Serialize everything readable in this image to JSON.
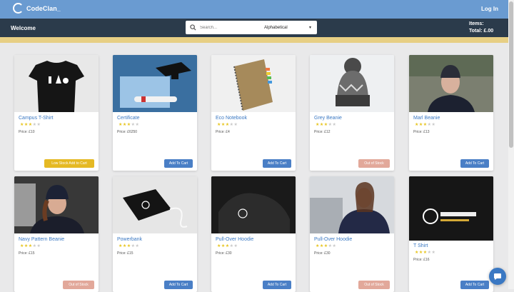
{
  "header": {
    "brand": "CodeClan_",
    "login_label": "Log In"
  },
  "nav": {
    "welcome": "Welcome",
    "search_placeholder": "Search...",
    "sort_selected": "Alphabetical",
    "items_label": "Items:",
    "total_label": "Total: £.00"
  },
  "colors": {
    "topbar": "#6a9bd1",
    "navbar": "#2b3b4b",
    "accent": "#e7cf84",
    "link": "#3a78c3",
    "add_button": "#4a7fc6",
    "low_stock_button": "#e5b924",
    "out_of_stock_button": "#e2a89a"
  },
  "products": [
    {
      "name": "Campus T-Shirt",
      "price": "Price: £10",
      "rating": 3,
      "button": "Low Stock Add to Cart",
      "status": "low"
    },
    {
      "name": "Certificate",
      "price": "Price: £6250",
      "rating": 3,
      "button": "Add To Cart",
      "status": "add"
    },
    {
      "name": "Eco Notebook",
      "price": "Price: £4",
      "rating": 3,
      "button": "Add To Cart",
      "status": "add"
    },
    {
      "name": "Grey Beanie",
      "price": "Price: £12",
      "rating": 3,
      "button": "Out of Stock",
      "status": "out"
    },
    {
      "name": "Marl Beanie",
      "price": "Price: £13",
      "rating": 3,
      "button": "Add To Cart",
      "status": "add"
    },
    {
      "name": "Navy Pattern Beanie",
      "price": "Price: £15",
      "rating": 3,
      "button": "Out of Stock",
      "status": "out"
    },
    {
      "name": "Powerbank",
      "price": "Price: £15",
      "rating": 3,
      "button": "Add To Cart",
      "status": "add"
    },
    {
      "name": "Pull-Over Hoodie",
      "price": "Price: £30",
      "rating": 3,
      "button": "Add To Cart",
      "status": "add"
    },
    {
      "name": "Pull-Over Hoodie",
      "price": "Price: £30",
      "rating": 3,
      "button": "Out of Stock",
      "status": "out"
    },
    {
      "name": "T Shirt",
      "price": "Price: £16",
      "rating": 3,
      "button": "Add To Cart",
      "status": "add"
    }
  ]
}
